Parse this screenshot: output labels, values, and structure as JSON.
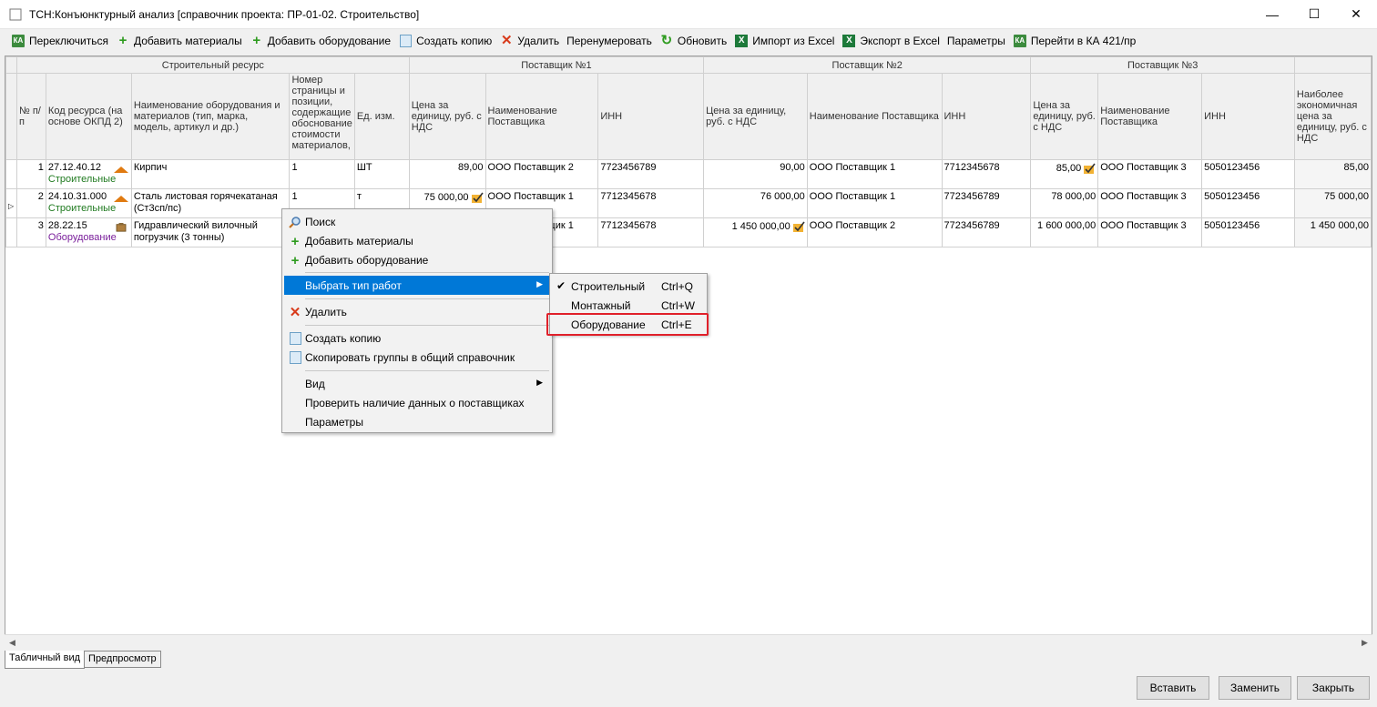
{
  "window": {
    "title": "ТСН:Конъюнктурный анализ [справочник проекта: ПР-01-02. Строительство]",
    "controls": {
      "minimize": "—",
      "maximize": "☐",
      "close": "✕"
    }
  },
  "toolbar": {
    "items": [
      {
        "label": "Переключиться",
        "icon": "switch-icon"
      },
      {
        "label": "Добавить материалы",
        "icon": "plus-icon"
      },
      {
        "label": "Добавить оборудование",
        "icon": "plus-icon"
      },
      {
        "label": "Создать копию",
        "icon": "copy-icon"
      },
      {
        "label": "Удалить",
        "icon": "delete-icon"
      },
      {
        "label": "Перенумеровать",
        "icon": ""
      },
      {
        "label": "Обновить",
        "icon": "refresh-icon"
      },
      {
        "label": "Импорт из Excel",
        "icon": "excel-icon"
      },
      {
        "label": "Экспорт в Excel",
        "icon": "excel-icon"
      },
      {
        "label": "Параметры",
        "icon": ""
      },
      {
        "label": "Перейти в КА 421/пр",
        "icon": "goto-icon"
      }
    ]
  },
  "grid": {
    "group_headers": {
      "resource": "Строительный ресурс",
      "supplier1": "Поставщик №1",
      "supplier2": "Поставщик №2",
      "supplier3": "Поставщик №3"
    },
    "columns": {
      "num": "№ п/п",
      "code": "Код ресурса (на основе ОКПД 2)",
      "name": "Наименование оборудования и материалов (тип, марка, модель, артикул и др.)",
      "page": "Номер страницы и позиции, содержащие обоснование стоимости материалов,",
      "unit": "Ед. изм.",
      "s1_price": "Цена за единицу, руб. с НДС",
      "s1_name": "Наименование Поставщика",
      "s1_inn": "ИНН",
      "s2_price": "Цена за единицу, руб. с НДС",
      "s2_name": "Наименование Поставщика",
      "s2_inn": "ИНН",
      "s3_price": "Цена за единицу, руб. с НДС",
      "s3_name": "Наименование Поставщика",
      "s3_inn": "ИНН",
      "best": "Наиболее экономичная цена за единицу, руб. с НДС"
    },
    "rows": [
      {
        "num": "1",
        "code": "27.12.40.12",
        "type": "Строительные",
        "name": "Кирпич",
        "page": "1",
        "unit": "ШТ",
        "s1_price": "89,00",
        "s1_name": "ООО Поставщик 2",
        "s1_inn": "7723456789",
        "s2_price": "90,00",
        "s2_name": "ООО Поставщик 1",
        "s2_inn": "7712345678",
        "s3_price": "85,00",
        "s3_name": "ООО Поставщик 3",
        "s3_inn": "5050123456",
        "best": "85,00"
      },
      {
        "num": "2",
        "code": "24.10.31.000",
        "type": "Строительные",
        "name": "Сталь листовая горячекатаная (Ст3сп/пс)",
        "page": "1",
        "unit": "т",
        "s1_price": "75 000,00",
        "s1_name": "ООО Поставщик 1",
        "s1_inn": "7712345678",
        "s2_price": "76 000,00",
        "s2_name": "ООО Поставщик 1",
        "s2_inn": "7723456789",
        "s3_price": "78 000,00",
        "s3_name": "ООО Поставщик 3",
        "s3_inn": "5050123456",
        "best": "75 000,00"
      },
      {
        "num": "3",
        "code": "28.22.15",
        "type": "Оборудование",
        "name": "Гидравлический вилочный погрузчик (3 тонны)",
        "page": "",
        "unit": "",
        "s1_price": "",
        "s1_name": "ООО Поставщик 1",
        "s1_name_visible": "ик 1",
        "s1_inn": "7712345678",
        "s2_price": "1 450 000,00",
        "s2_name": "ООО Поставщик 2",
        "s2_inn": "7723456789",
        "s3_price": "1 600 000,00",
        "s3_name": "ООО Поставщик 3",
        "s3_inn": "5050123456",
        "best": "1 450 000,00"
      }
    ]
  },
  "context_menu": {
    "items": [
      {
        "label": "Поиск",
        "icon": "search-icon"
      },
      {
        "label": "Добавить материалы",
        "icon": "plus-icon"
      },
      {
        "label": "Добавить оборудование",
        "icon": "plus-icon"
      },
      {
        "label": "Выбрать тип работ",
        "icon": "",
        "submenu": true,
        "highlighted": true
      },
      {
        "label": "Удалить",
        "icon": "delete-icon"
      },
      {
        "label": "Создать копию",
        "icon": "copy-icon"
      },
      {
        "label": "Скопировать группы в общий справочник",
        "icon": "copy-icon"
      },
      {
        "label": "Вид",
        "icon": "",
        "submenu": true
      },
      {
        "label": "Проверить наличие данных о поставщиках",
        "icon": ""
      },
      {
        "label": "Параметры",
        "icon": ""
      }
    ]
  },
  "submenu": {
    "items": [
      {
        "label": "Строительный",
        "shortcut": "Ctrl+Q",
        "checked": true
      },
      {
        "label": "Монтажный",
        "shortcut": "Ctrl+W",
        "checked": false
      },
      {
        "label": "Оборудование",
        "shortcut": "Ctrl+E",
        "checked": false,
        "highlighted_box": true
      }
    ]
  },
  "tabs": {
    "table": "Табличный вид",
    "preview": "Предпросмотр"
  },
  "buttons": {
    "insert": "Вставить",
    "replace": "Заменить",
    "close": "Закрыть"
  },
  "colors": {
    "accent": "#0078d7",
    "highlight_box": "#e0202a",
    "type_build": "#1f7a1f",
    "type_equip": "#7a1f9b"
  }
}
